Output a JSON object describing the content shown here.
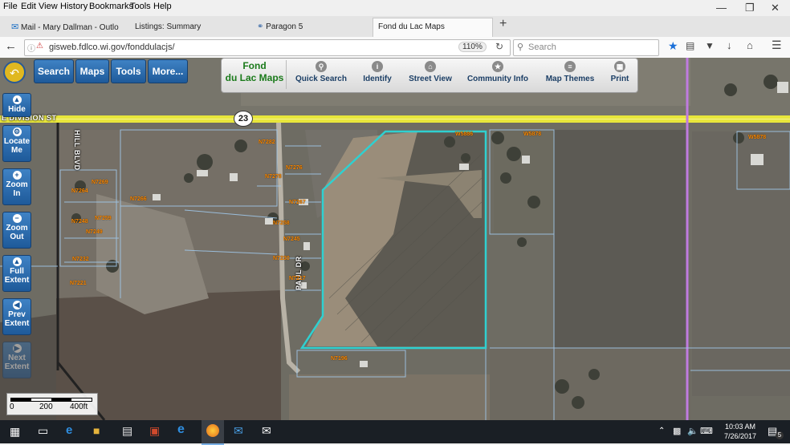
{
  "menubar": {
    "items": [
      "File",
      "Edit",
      "View",
      "History",
      "Bookmarks",
      "Tools",
      "Help"
    ]
  },
  "tabs": [
    {
      "label": "Mail - Mary Dallman - Outlo",
      "icon": "mail-icon",
      "active": false
    },
    {
      "label": "Listings: Summary",
      "icon": "",
      "active": false
    },
    {
      "label": "Paragon 5",
      "icon": "paragon-icon",
      "active": false
    },
    {
      "label": "Fond du Lac Maps",
      "icon": "",
      "active": true
    }
  ],
  "navbar": {
    "url": "gisweb.fdlco.wi.gov/fonddulacjs/",
    "zoom": "110%",
    "search_placeholder": "Search"
  },
  "map_ui": {
    "top_buttons": [
      "Search",
      "Maps",
      "Tools",
      "More..."
    ],
    "title_line1": "Fond",
    "title_line2": "du Lac Maps",
    "tools": [
      "Quick Search",
      "Identify",
      "Street View",
      "Community Info",
      "Map Themes",
      "Print"
    ],
    "side_buttons": [
      {
        "line1": "Hide",
        "line2": ""
      },
      {
        "line1": "Locate",
        "line2": "Me"
      },
      {
        "line1": "Zoom",
        "line2": "In"
      },
      {
        "line1": "Zoom",
        "line2": "Out"
      },
      {
        "line1": "Full",
        "line2": "Extent"
      },
      {
        "line1": "Prev",
        "line2": "Extent"
      },
      {
        "line1": "Next",
        "line2": "Extent"
      }
    ],
    "scale": {
      "labels": [
        "0",
        "200",
        "400ft"
      ]
    }
  },
  "streets": {
    "division": "E DIVISION ST",
    "hill": "HILL BLVD",
    "paul": "PAUL DR",
    "highway_shield": "23"
  },
  "parcels": [
    "N7282",
    "N7276",
    "N7278",
    "N7269",
    "N7264",
    "N7266",
    "N7267",
    "N7258",
    "N7259",
    "N7248",
    "N7245",
    "N7249",
    "N7232",
    "N7230",
    "N7221",
    "N7217",
    "N7196",
    "W5886",
    "W5878",
    "W5878"
  ],
  "taskbar": {
    "time": "10:03 AM",
    "date": "7/26/2017",
    "notification_count": "5"
  },
  "colors": {
    "highway": "#e8e63c",
    "parcel_line": "#9fc6e8",
    "selected_parcel": "#2fd0d0",
    "boundary": "#c07be0",
    "button_blue": "#2a6cb0"
  }
}
